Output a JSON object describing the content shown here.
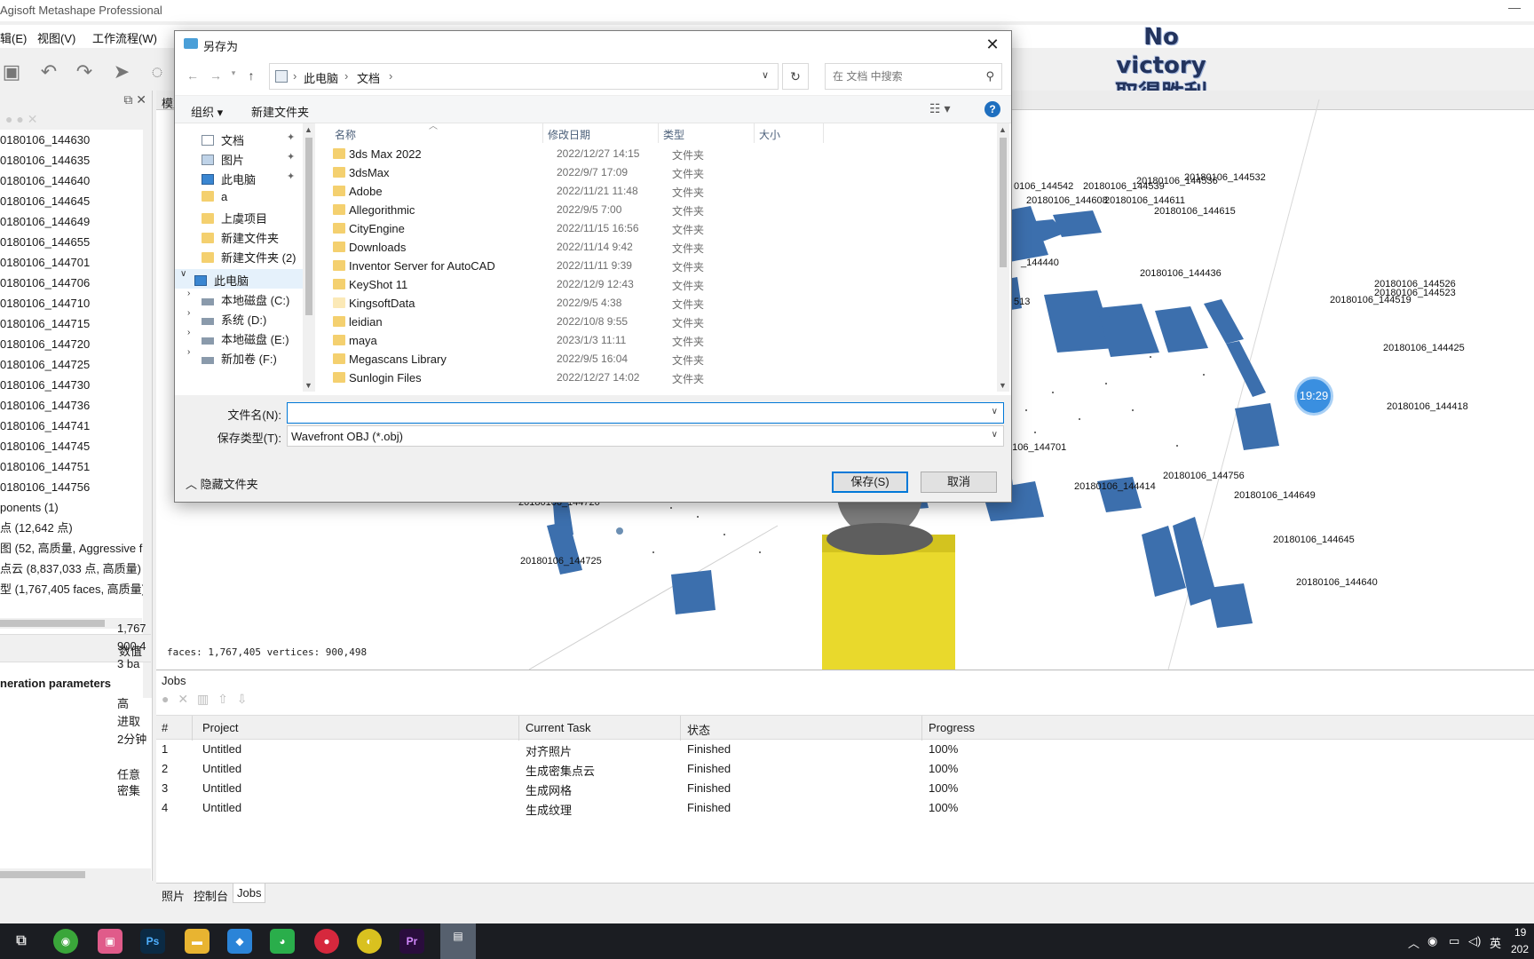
{
  "app": {
    "title": "Agisoft Metashape Professional",
    "minimize": "—",
    "menu": [
      "辑(E)",
      "视图(V)",
      "工作流程(W)"
    ],
    "overlay_line1": "No victory",
    "overlay_line2": "取得胜利"
  },
  "left_panel": {
    "items": [
      "0180106_144630",
      "0180106_144635",
      "0180106_144640",
      "0180106_144645",
      "0180106_144649",
      "0180106_144655",
      "0180106_144701",
      "0180106_144706",
      "0180106_144710",
      "0180106_144715",
      "0180106_144720",
      "0180106_144725",
      "0180106_144730",
      "0180106_144736",
      "0180106_144741",
      "0180106_144745",
      "0180106_144751",
      "0180106_144756",
      "ponents (1)",
      "点 (12,642 点)",
      "图 (52, 高质量, Aggressive filt",
      "点云 (8,837,033 点, 高质量)",
      "型 (1,767,405 faces, 高质量)"
    ],
    "props_header_value": "数值",
    "props": [
      {
        "val": "1,767"
      },
      {
        "val": "900,4"
      },
      {
        "val": "3 ba"
      },
      {
        "key": "neration parameters"
      },
      {
        "val": "高"
      },
      {
        "val": "进取"
      },
      {
        "val": "2分钟"
      },
      {
        "val": ""
      },
      {
        "val": "任意"
      },
      {
        "val": "密集"
      }
    ]
  },
  "viewport": {
    "tab": "模型",
    "stats": "faces: 1,767,405 vertices: 900,498",
    "clock": "19:29",
    "labels": [
      "0106_144542",
      "20180106_144539",
      "20180106_144536",
      "20180106_144532",
      "20180106_144608",
      "20180106_144611",
      "20180106_144615",
      "_144440",
      "20180106_144436",
      "20180106_144526",
      "20180106_144523",
      "20180106_144519",
      "513",
      "20180106_144425",
      "20180106_144418",
      "0106_144701",
      "20180106_144756",
      "20180106_144414",
      "20180106_144715",
      "20180106_144649",
      "20180106_144720",
      "20180106_144645",
      "20180106_144725",
      "20180106_144640"
    ]
  },
  "jobs": {
    "title": "Jobs",
    "columns": [
      "#",
      "Project",
      "Current Task",
      "状态",
      "Progress"
    ],
    "rows": [
      [
        "1",
        "Untitled",
        "对齐照片",
        "Finished",
        "100%"
      ],
      [
        "2",
        "Untitled",
        "生成密集点云",
        "Finished",
        "100%"
      ],
      [
        "3",
        "Untitled",
        "生成网格",
        "Finished",
        "100%"
      ],
      [
        "4",
        "Untitled",
        "生成纹理",
        "Finished",
        "100%"
      ]
    ]
  },
  "bottom_tabs": [
    "照片",
    "控制台",
    "Jobs"
  ],
  "dialog": {
    "title": "另存为",
    "breadcrumb": [
      "此电脑",
      "文档"
    ],
    "search_placeholder": "在 文档 中搜索",
    "organize": "组织 ▾",
    "new_folder": "新建文件夹",
    "help": "?",
    "nav_tree": [
      {
        "label": "文档",
        "icon": "doc",
        "pin": true
      },
      {
        "label": "图片",
        "icon": "pic",
        "pin": true
      },
      {
        "label": "此电脑",
        "icon": "pc",
        "pin": true
      },
      {
        "label": "a",
        "icon": "folder"
      },
      {
        "label": "上虞项目",
        "icon": "folder"
      },
      {
        "label": "新建文件夹",
        "icon": "folder"
      },
      {
        "label": "新建文件夹 (2)",
        "icon": "folder"
      },
      {
        "label": "此电脑",
        "icon": "pc",
        "expanded": true
      },
      {
        "label": "本地磁盘 (C:)",
        "icon": "drive"
      },
      {
        "label": "系统 (D:)",
        "icon": "drive"
      },
      {
        "label": "本地磁盘 (E:)",
        "icon": "drive"
      },
      {
        "label": "新加卷 (F:)",
        "icon": "drive"
      }
    ],
    "columns": [
      "名称",
      "修改日期",
      "类型",
      "大小"
    ],
    "files": [
      {
        "name": "3ds Max 2022",
        "date": "2022/12/27 14:15",
        "type": "文件夹"
      },
      {
        "name": "3dsMax",
        "date": "2022/9/7 17:09",
        "type": "文件夹"
      },
      {
        "name": "Adobe",
        "date": "2022/11/21 11:48",
        "type": "文件夹"
      },
      {
        "name": "Allegorithmic",
        "date": "2022/9/5 7:00",
        "type": "文件夹"
      },
      {
        "name": "CityEngine",
        "date": "2022/11/15 16:56",
        "type": "文件夹"
      },
      {
        "name": "Downloads",
        "date": "2022/11/14 9:42",
        "type": "文件夹"
      },
      {
        "name": "Inventor Server for AutoCAD",
        "date": "2022/11/11 9:39",
        "type": "文件夹"
      },
      {
        "name": "KeyShot 11",
        "date": "2022/12/9 12:43",
        "type": "文件夹"
      },
      {
        "name": "KingsoftData",
        "date": "2022/9/5 4:38",
        "type": "文件夹"
      },
      {
        "name": "leidian",
        "date": "2022/10/8 9:55",
        "type": "文件夹"
      },
      {
        "name": "maya",
        "date": "2023/1/3 11:11",
        "type": "文件夹"
      },
      {
        "name": "Megascans Library",
        "date": "2022/9/5 16:04",
        "type": "文件夹"
      },
      {
        "name": "Sunlogin Files",
        "date": "2022/12/27 14:02",
        "type": "文件夹"
      }
    ],
    "filename_label": "文件名(N):",
    "filename_value": "",
    "filetype_label": "保存类型(T):",
    "filetype_value": "Wavefront OBJ (*.obj)",
    "hide_folders": "隐藏文件夹",
    "save": "保存(S)",
    "cancel": "取消"
  },
  "taskbar": {
    "tray": [
      "英"
    ],
    "clock_partial": "19",
    "date_partial": "202"
  }
}
